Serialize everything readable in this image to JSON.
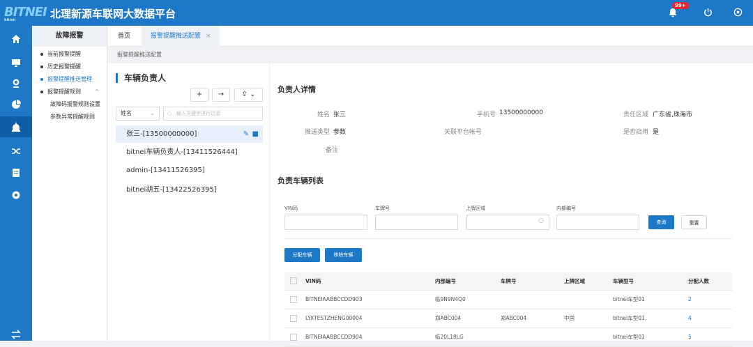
{
  "header": {
    "logo": "BITNEI",
    "logo_sub": "bitnei",
    "title": "北理新源车联网大数据平台",
    "badge": "99+"
  },
  "menu": {
    "title": "故障报警",
    "items": [
      {
        "label": "当前报警提醒"
      },
      {
        "label": "历史报警提醒"
      },
      {
        "label": "报警提醒推送管理"
      },
      {
        "label": "报警提醒规则",
        "arrow": "^"
      }
    ],
    "subitems": [
      {
        "label": "故障码报警规则设置"
      },
      {
        "label": "参数异常提醒规则"
      }
    ]
  },
  "tabs": {
    "home": "首页",
    "active": "报警提醒推送配置",
    "close": "×"
  },
  "breadcrumb": "报警提醒推送配置",
  "left": {
    "title": "车辆负责人",
    "select_value": "姓名",
    "search_placeholder": "输入关键字进行过滤",
    "persons": [
      "张三-[13500000000]",
      "bitnei车辆负责人-[13411526444]",
      "admin-[13411526395]",
      "bitnei胡五-[13422526395]"
    ]
  },
  "detail": {
    "title": "负责人详情",
    "name_label": "姓名",
    "name_value": "张三",
    "phone_label": "手机号",
    "phone_value": "13500000000",
    "area_label": "责任区域",
    "area_value": "广东省,珠海市",
    "push_label": "推送类型",
    "push_value": "参数",
    "platform_label": "关联平台帐号",
    "platform_value": "",
    "enabled_label": "是否启用",
    "enabled_value": "是",
    "remark_label": "备注",
    "remark_value": ""
  },
  "vehicles": {
    "title": "负责车辆列表",
    "vin_label": "VIN码",
    "plate_label": "车牌号",
    "area_label": "上牌区域",
    "internal_label": "内部编号",
    "query_btn": "查询",
    "reset_btn": "重置",
    "assign_btn": "分配车辆",
    "remove_btn": "移除车辆",
    "columns": [
      "VIN码",
      "内部编号",
      "车牌号",
      "上牌区域",
      "车辆型号",
      "分配人数"
    ],
    "rows": [
      [
        "BITNEIAABBCCDD903",
        "临9N9N4Q0",
        "",
        "",
        "bitnei车型01",
        "2"
      ],
      [
        "LYKTESTZHENG00004",
        "郑ABC004",
        "郑ABC004",
        "中国",
        "bitnei车型01",
        "4"
      ],
      [
        "BITNEIAABBCCDD904",
        "临20L18LG",
        "",
        "",
        "bitnei车型01",
        "5"
      ]
    ]
  },
  "colors": {
    "primary": "#1e78c8",
    "badge": "#f5222d"
  }
}
